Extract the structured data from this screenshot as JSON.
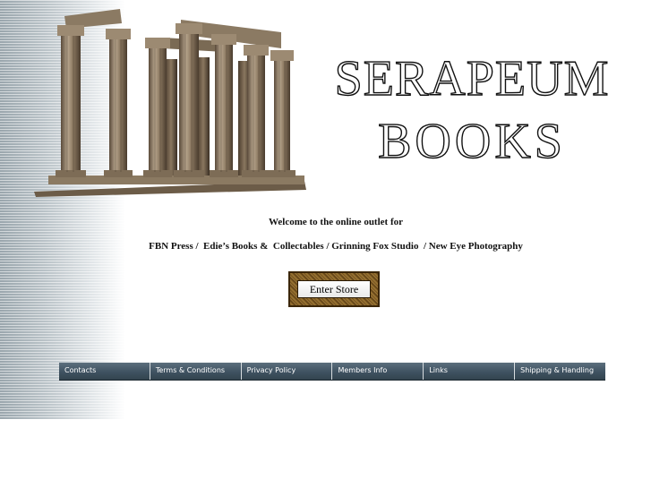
{
  "header": {
    "title_line1": "SERAPEUM",
    "title_line2": "BOOKS",
    "image": "temple-columns-image"
  },
  "main": {
    "welcome": "Welcome to the online outlet for",
    "outlets": "FBN Press /  Edie’s Books &  Collectables / Grinning Fox Studio  / New Eye Photography",
    "enter_store_label": "Enter Store"
  },
  "nav": {
    "items": [
      {
        "label": "Contacts"
      },
      {
        "label": "Terms & Conditions"
      },
      {
        "label": "Privacy Policy"
      },
      {
        "label": "Members Info"
      },
      {
        "label": "Links"
      },
      {
        "label": "Shipping & Handling"
      }
    ]
  },
  "colors": {
    "nav_background": "#3f5261",
    "nav_text": "#ffffff",
    "frame": "#8a6a2c"
  }
}
